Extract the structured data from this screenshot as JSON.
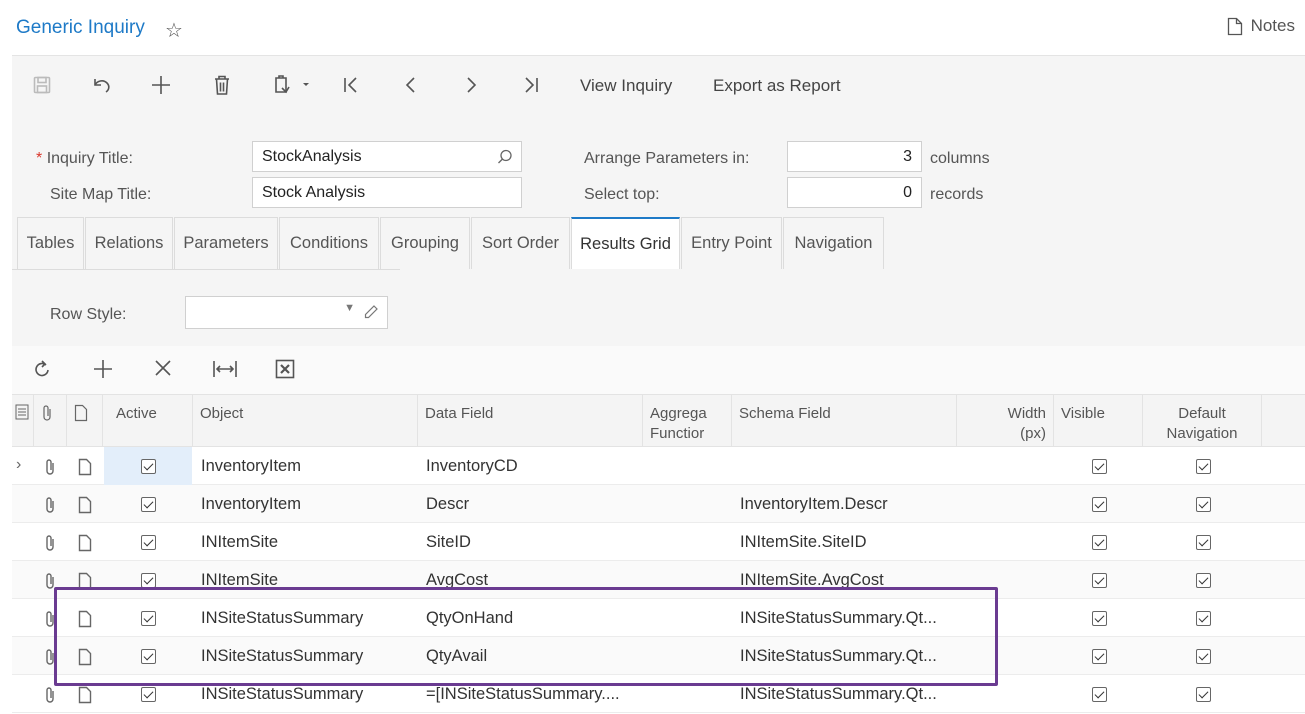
{
  "header": {
    "title": "Generic Inquiry",
    "notes_label": "Notes"
  },
  "toolbar": {
    "icons": [
      "save-icon",
      "undo-icon",
      "add-icon",
      "delete-icon",
      "copy-paste-icon",
      "first-icon",
      "previous-icon",
      "next-icon",
      "last-icon"
    ],
    "view_inquiry": "View Inquiry",
    "export_as_report": "Export as Report"
  },
  "form": {
    "required_mark": "*",
    "inquiry_title_label": "Inquiry Title:",
    "inquiry_title_value": "StockAnalysis",
    "site_map_title_label": "Site Map Title:",
    "site_map_title_value": "Stock Analysis",
    "arrange_label": "Arrange Parameters in:",
    "arrange_value": "3",
    "arrange_unit": "columns",
    "select_top_label": "Select top:",
    "select_top_value": "0",
    "select_top_unit": "records"
  },
  "tabs": [
    "Tables",
    "Relations",
    "Parameters",
    "Conditions",
    "Grouping",
    "Sort Order",
    "Results Grid",
    "Entry Point",
    "Navigation"
  ],
  "active_tab": "Results Grid",
  "row_style": {
    "label": "Row Style:",
    "value": ""
  },
  "grid": {
    "toolbar_icons": [
      "refresh-icon",
      "add-row-icon",
      "delete-row-icon",
      "fit-columns-icon",
      "export-excel-icon"
    ],
    "columns": {
      "active": "Active",
      "object": "Object",
      "data_field": "Data Field",
      "aggregate": "Aggrega Functior",
      "schema_field": "Schema Field",
      "width": "Width (px)",
      "visible": "Visible",
      "default_navigation": "Default Navigation"
    },
    "rows": [
      {
        "object": "InventoryItem",
        "data_field": "InventoryCD",
        "schema_field": "",
        "active": true,
        "visible": true,
        "default_navigation": true
      },
      {
        "object": "InventoryItem",
        "data_field": "Descr",
        "schema_field": "InventoryItem.Descr",
        "active": true,
        "visible": true,
        "default_navigation": true
      },
      {
        "object": "INItemSite",
        "data_field": "SiteID",
        "schema_field": "INItemSite.SiteID",
        "active": true,
        "visible": true,
        "default_navigation": true
      },
      {
        "object": "INItemSite",
        "data_field": "AvgCost",
        "schema_field": "INItemSite.AvgCost",
        "active": true,
        "visible": true,
        "default_navigation": true
      },
      {
        "object": "INSiteStatusSummary",
        "data_field": "QtyOnHand",
        "schema_field": "INSiteStatusSummary.Qt...",
        "active": true,
        "visible": true,
        "default_navigation": true
      },
      {
        "object": "INSiteStatusSummary",
        "data_field": "QtyAvail",
        "schema_field": "INSiteStatusSummary.Qt...",
        "active": true,
        "visible": true,
        "default_navigation": true
      },
      {
        "object": "INSiteStatusSummary",
        "data_field": "=[INSiteStatusSummary....",
        "schema_field": "INSiteStatusSummary.Qt...",
        "active": true,
        "visible": true,
        "default_navigation": true
      }
    ]
  },
  "colors": {
    "accent": "#1e7ac7",
    "highlight_border": "#6a3b91",
    "required": "#d9362b"
  }
}
